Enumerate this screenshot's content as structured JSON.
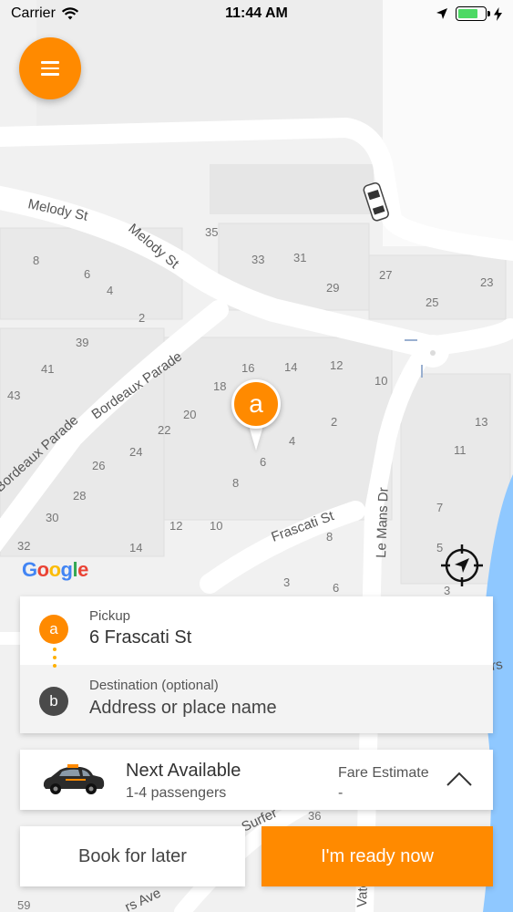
{
  "status_bar": {
    "carrier": "Carrier",
    "time": "11:44 AM",
    "battery_level": 0.75
  },
  "map": {
    "streets": [
      "Melody St",
      "Melody St",
      "Bordeaux Parade",
      "Bordeaux Parade",
      "Frascati St",
      "Le Mans Dr",
      "Surfer",
      "rs Ave",
      "rs",
      "Vate"
    ],
    "house_numbers": [
      "8",
      "6",
      "4",
      "2",
      "35",
      "33",
      "31",
      "29",
      "27",
      "25",
      "23",
      "39",
      "41",
      "43",
      "16",
      "14",
      "12",
      "10",
      "18",
      "20",
      "22",
      "24",
      "26",
      "28",
      "30",
      "32",
      "13",
      "11",
      "7",
      "5",
      "3",
      "2",
      "4",
      "6",
      "8",
      "10",
      "12",
      "14",
      "3",
      "6",
      "8",
      "36",
      "59"
    ],
    "google_logo": "Google",
    "logo_letters": {
      "G": "#4285f4",
      "o1": "#ea4335",
      "o2": "#fbbc05",
      "g": "#4285f4",
      "l": "#34a853",
      "e": "#ea4335"
    },
    "pin_label": "a",
    "accent_color": "#ff8a00"
  },
  "icons": {
    "menu": "menu-icon",
    "locate": "crosshair-icon",
    "wifi": "wifi-icon",
    "location": "location-arrow-icon",
    "charging": "bolt-icon",
    "chevron": "chevron-up-icon",
    "taxi": "taxi-icon"
  },
  "address_card": {
    "pickup": {
      "badge": "a",
      "label": "Pickup",
      "value": "6 Frascati St"
    },
    "destination": {
      "badge": "b",
      "label": "Destination (optional)",
      "placeholder": "Address or place name"
    }
  },
  "vehicle": {
    "title": "Next Available",
    "subtitle": "1-4 passengers",
    "fare_label": "Fare Estimate",
    "fare_value": "-"
  },
  "actions": {
    "book_later": "Book for later",
    "ready_now": "I'm ready now"
  }
}
